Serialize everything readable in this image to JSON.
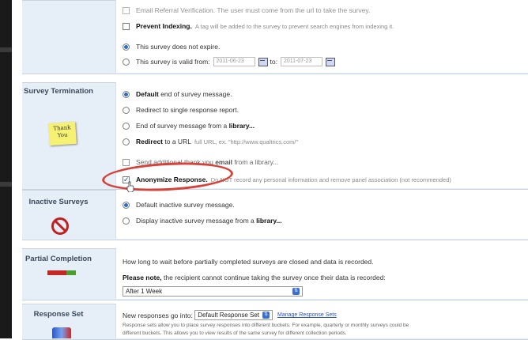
{
  "top_section": {
    "cut_off_row": "Email Referral Verification. The user must come from the url to take the survey.",
    "prevent_indexing_label": "Prevent Indexing.",
    "prevent_indexing_desc": "A tag will be added to the survey to prevent search engines from indexing it.",
    "no_expire_label": "This survey does not expire.",
    "valid_from_label": "This survey is valid from:",
    "valid_from_date": "2011-06-23",
    "to_label": "to:",
    "valid_to_date": "2011-07-23"
  },
  "survey_termination": {
    "label": "Survey Termination",
    "sticky_text": "Thank You",
    "default_bold": "Default",
    "default_rest": "end of survey message.",
    "redirect_report": "Redirect to single response report.",
    "library_msg_prefix": "End of survey message from a",
    "library_msg_bold": "library...",
    "redirect_url_bold": "Redirect",
    "redirect_url_rest": "to a URL",
    "redirect_url_hint": "full URL, ex. \"http://www.qualtrics.com/\"",
    "send_thanks_prefix": "Send additional thank you",
    "send_thanks_bold": "email",
    "send_thanks_suffix": "from a library...",
    "anonymize_label": "Anonymize Response.",
    "anonymize_desc": "Do NOT record any personal information and remove panel association (not recommended)"
  },
  "inactive_surveys": {
    "label": "Inactive Surveys",
    "default_msg": "Default inactive survey message.",
    "library_prefix": "Display inactive survey message from a",
    "library_bold": "library..."
  },
  "partial_completion": {
    "label": "Partial Completion",
    "question": "How long to wait before partially completed surveys are closed and data is recorded.",
    "note_bold": "Please note,",
    "note_rest": "the recipient cannot continue taking the survey once their data is recorded:",
    "selected": "After 1 Week"
  },
  "response_set": {
    "label": "Response Set",
    "prefix": "New responses go into:",
    "selected": "Default Response Set",
    "manage_link": "Manage Response Sets",
    "desc_line1": "Response sets allow you to place survey responses into different buckets. For example, quarterly or monthly surveys could be",
    "desc_line2": "different buckets. This allows you to view results of the same survey for different collection periods."
  },
  "colors": {
    "panel_bg": "#e6eef7",
    "accent_blue": "#2b6cc4",
    "highlight_red": "#d8413a"
  }
}
